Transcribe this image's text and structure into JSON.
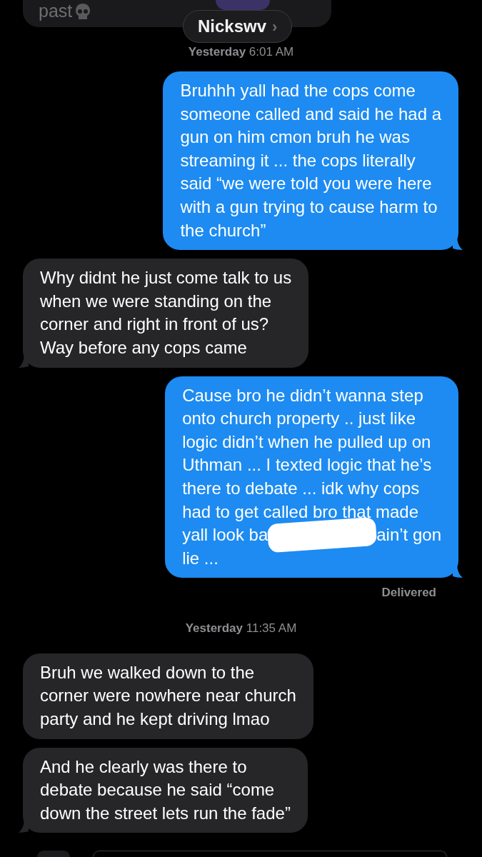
{
  "contact": {
    "name": "Nickswv",
    "chevron": "›"
  },
  "top_message": {
    "text": "past"
  },
  "thread": [
    {
      "kind": "timestamp",
      "day": "Yesterday",
      "time": "6:01 AM"
    },
    {
      "kind": "message",
      "outgoing": true,
      "tail": true,
      "text": "Bruhhh yall had the cops come\nsomeone called and said he had a\ngun on him cmon bruh he was\nstreaming it ... the cops literally\nsaid “we were told you were here\nwith a gun trying to cause harm to\nthe church”"
    },
    {
      "kind": "message",
      "outgoing": false,
      "tail": true,
      "text": "Why didnt he just come talk to us\nwhen we were standing on the\ncorner and right in front of us?\nWay before any cops came"
    },
    {
      "kind": "redacted",
      "outgoing": true,
      "tail": true,
      "text_top": "Cause bro he didn’t wanna step\nonto church property .. just like\nlogic didn’t when he pulled up on\nUthman ... I texted logic that he’s\nthere to debate ... idk why cops\nhad to get called bro that made",
      "line_left": "yall look ba",
      "line_right": "ain’t gon",
      "text_bottom": "lie ..."
    },
    {
      "kind": "status",
      "text": "Delivered"
    },
    {
      "kind": "timestamp",
      "day": "Yesterday",
      "time": "11:35 AM"
    },
    {
      "kind": "message",
      "outgoing": false,
      "tail": false,
      "text": "Bruh we walked down to the\ncorner were nowhere near church\nparty and he kept driving lmao"
    },
    {
      "kind": "message",
      "outgoing": false,
      "tail": true,
      "text": "And he clearly was there to\ndebate because he said “come\ndown the street lets run the fade”"
    }
  ]
}
